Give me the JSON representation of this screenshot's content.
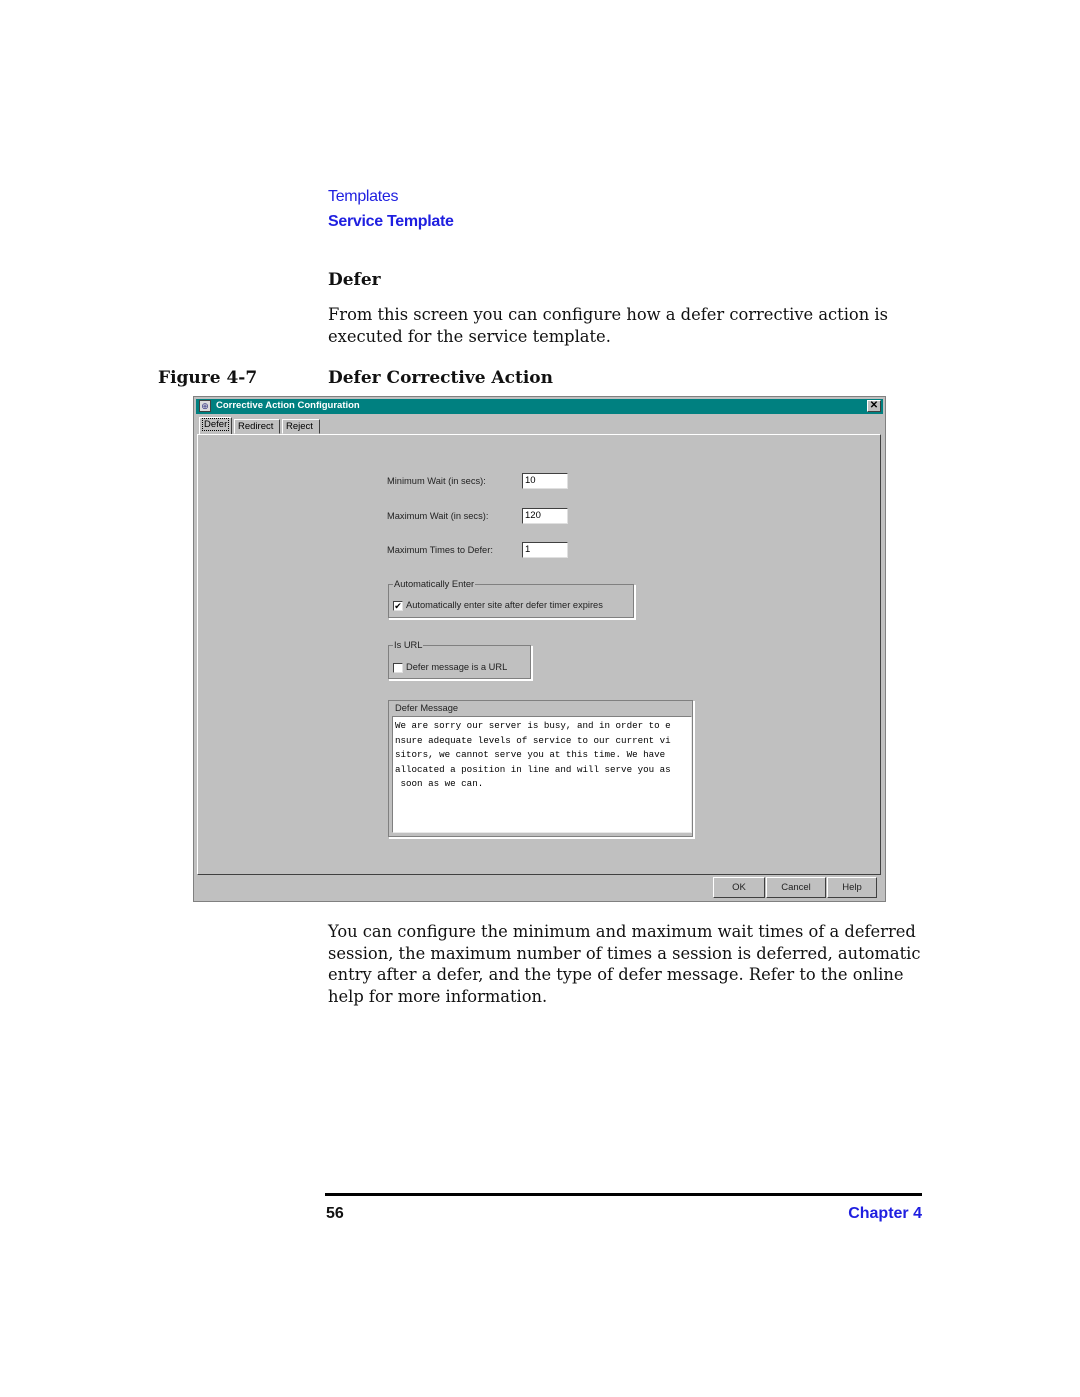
{
  "header": {
    "section": "Templates",
    "subsection": "Service Template"
  },
  "section_title": "Defer",
  "intro": "From this screen you can configure how a defer corrective action is executed for the service template.",
  "figure": {
    "label": "Figure 4-7",
    "title": "Defer Corrective Action"
  },
  "dialog": {
    "title": "Corrective Action Configuration",
    "close_glyph": "✕",
    "tabs": [
      {
        "label": "Defer",
        "active": true
      },
      {
        "label": "Redirect",
        "active": false
      },
      {
        "label": "Reject",
        "active": false
      }
    ],
    "fields": {
      "min_wait": {
        "label": "Minimum Wait (in secs):",
        "value": "10"
      },
      "max_wait": {
        "label": "Maximum Wait (in secs):",
        "value": "120"
      },
      "max_times": {
        "label": "Maximum Times to Defer:",
        "value": "1"
      }
    },
    "auto_enter": {
      "group_label": "Automatically Enter",
      "checkbox_label": "Automatically enter site after defer timer expires",
      "checked": true,
      "check_glyph": "✔"
    },
    "is_url": {
      "group_label": "Is URL",
      "checkbox_label": "Defer message is a URL",
      "checked": false
    },
    "defer_message": {
      "group_label": "Defer Message",
      "text": "We are sorry our server is busy, and in order to e\nnsure adequate levels of service to our current vi\nsitors, we cannot serve you at this time. We have \nallocated a position in line and will serve you as\n soon as we can."
    },
    "buttons": {
      "ok": "OK",
      "cancel": "Cancel",
      "help": "Help"
    }
  },
  "outro": "You can configure the minimum and maximum wait times of a deferred session, the maximum number of times a session is deferred, automatic entry after a defer, and the type of defer message. Refer to the online help for more information.",
  "footer": {
    "page_number": "56",
    "chapter": "Chapter 4"
  }
}
